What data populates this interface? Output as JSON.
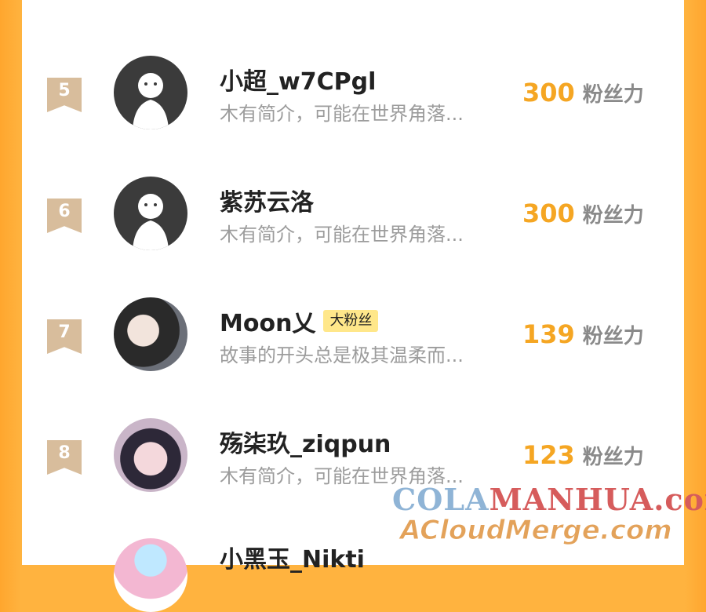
{
  "rows": [
    {
      "rank": "5",
      "avatar": "default-avatar",
      "name": "小超_w7CPgl",
      "badge": "",
      "bio": "木有简介，可能在世界角落...",
      "score": "300",
      "unit": "粉丝力"
    },
    {
      "rank": "6",
      "avatar": "default-avatar",
      "name": "紫苏云洛",
      "badge": "",
      "bio": "木有简介，可能在世界角落...",
      "score": "300",
      "unit": "粉丝力"
    },
    {
      "rank": "7",
      "avatar": "anime-avatar",
      "name": "Moon乂",
      "badge": "大粉丝",
      "bio": "故事的开头总是极其温柔而...",
      "score": "139",
      "unit": "粉丝力"
    },
    {
      "rank": "8",
      "avatar": "anime-avatar",
      "name": "殇柒玖_ziqpun",
      "badge": "",
      "bio": "木有简介，可能在世界角落...",
      "score": "123",
      "unit": "粉丝力"
    }
  ],
  "next_row": {
    "name_partial": "小黑玉_Nikti"
  },
  "watermark": {
    "line1_part1": "COLA",
    "line1_part2": "MANHUA.com",
    "line2": "ACloudMerge.com"
  },
  "colors": {
    "accent": "#f5a623",
    "background": "#ffb33f",
    "rank_badge": "#d8bd9c",
    "fan_badge": "#ffe78a"
  }
}
